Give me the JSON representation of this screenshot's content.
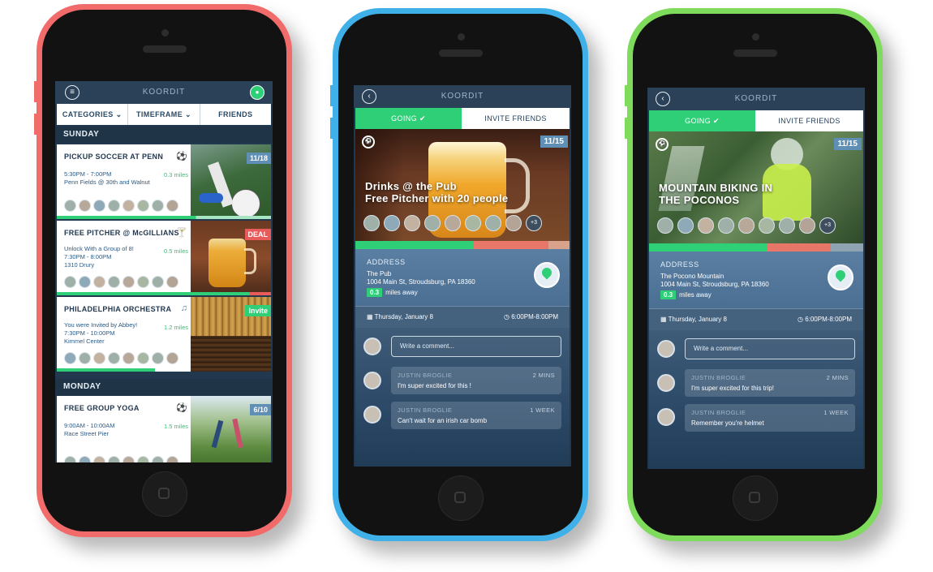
{
  "app_title": "KOORDIT",
  "list_screen": {
    "filters": [
      "CATEGORIES",
      "TIMEFRAME",
      "FRIENDS"
    ],
    "sections": [
      {
        "day": "SUNDAY"
      },
      {
        "day": "MONDAY"
      }
    ],
    "events": [
      {
        "title": "PICKUP SOCCER AT PENN",
        "line1": "5:30PM - 7:00PM",
        "line2": "Penn Fields @ 30th and Walnut",
        "line3": "",
        "miles": "0.3 miles",
        "badge": "11/18",
        "icon": "soccer-ball-icon"
      },
      {
        "title": "FREE PITCHER @ McGILLIANS",
        "line1": "Unlock With a Group of 8!",
        "line2": "7:30PM - 8:00PM",
        "line3": "1310 Drury",
        "miles": "0.5 miles",
        "badge": "DEAL",
        "icon": "cocktail-icon"
      },
      {
        "title": "PHILADELPHIA ORCHESTRA",
        "line1": "You were Invited by Abbey!",
        "line2": "7:30PM - 10:00PM",
        "line3": "Kimmel Center",
        "miles": "1.2 miles",
        "badge": "Invite",
        "icon": "music-note-icon"
      },
      {
        "title": "FREE GROUP YOGA",
        "line1": "9:00AM - 10:00AM",
        "line2": "Race Street Pier",
        "line3": "",
        "miles": "1.5 miles",
        "badge": "6/10",
        "icon": "soccer-ball-icon"
      }
    ]
  },
  "detail_pub": {
    "tab_going": "GOING ✔",
    "tab_invite": "INVITE FRIENDS",
    "badge": "11/15",
    "hero_line1": "Drinks @ the Pub",
    "hero_line2": "Free Pitcher with 20 people",
    "more": "+3",
    "address_label": "ADDRESS",
    "venue": "The Pub",
    "street": "1004 Main St, Stroudsburg, PA 18360",
    "miles_value": "0.3",
    "miles_suffix": "miles away",
    "date": "Thursday, January 8",
    "time": "6:00PM-8:00PM",
    "comment_placeholder": "Write a comment...",
    "comments": [
      {
        "name": "JUSTIN BROGLIE",
        "time": "2 MINS",
        "text": "I'm super excited for this !"
      },
      {
        "name": "JUSTIN BROGLIE",
        "time": "1 WEEK",
        "text": "Can't wait for an irish car bomb"
      }
    ]
  },
  "detail_bike": {
    "tab_going": "GOING ✔",
    "tab_invite": "INVITE FRIENDS",
    "badge": "11/15",
    "hero_line1": "MOUNTAIN BIKING IN",
    "hero_line2": "THE POCONOS",
    "more": "+3",
    "address_label": "ADDRESS",
    "venue": "The Pocono Mountain",
    "street": "1004 Main St, Stroudsburg, PA 18360",
    "miles_value": "0.3",
    "miles_suffix": "miles away",
    "date": "Thursday, January 8",
    "time": "6:00PM-8:00PM",
    "comment_placeholder": "Write a comment...",
    "comments": [
      {
        "name": "JUSTIN BROGLIE",
        "time": "2 MINS",
        "text": "I'm super excited for this trip!"
      },
      {
        "name": "JUSTIN BROGLIE",
        "time": "1 WEEK",
        "text": "Remember you're helmet"
      }
    ]
  },
  "colors": {
    "phone_red": "#f26b6b",
    "phone_blue": "#3fb0e8",
    "phone_green": "#7edb5b",
    "accent_green": "#2fcf78",
    "navy": "#22384f"
  }
}
